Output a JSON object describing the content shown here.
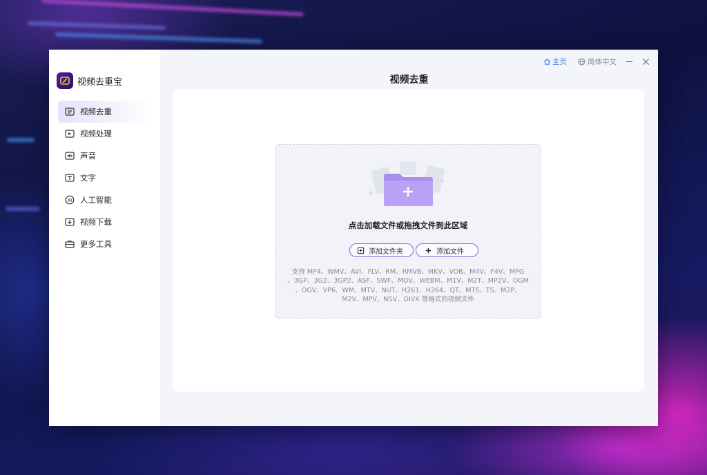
{
  "app": {
    "name": "视频去重宝"
  },
  "topbar": {
    "home_label": "主页",
    "lang_label": "简体中文"
  },
  "sidebar": {
    "items": [
      {
        "label": "视频去重",
        "icon": "video-dedupe-icon",
        "active": true
      },
      {
        "label": "视频处理",
        "icon": "video-process-icon",
        "active": false
      },
      {
        "label": "声音",
        "icon": "audio-icon",
        "active": false
      },
      {
        "label": "文字",
        "icon": "text-icon",
        "active": false
      },
      {
        "label": "人工智能",
        "icon": "ai-icon",
        "active": false
      },
      {
        "label": "视频下载",
        "icon": "download-icon",
        "active": false
      },
      {
        "label": "更多工具",
        "icon": "toolbox-icon",
        "active": false
      }
    ]
  },
  "main": {
    "title": "视频去重",
    "drop_text": "点击加载文件或拖拽文件到此区域",
    "add_folder_label": "添加文件夹",
    "add_file_label": "添加文件",
    "formats_lines": [
      "支持 MP4、WMV、AVI、FLV、RM、RMVB、MKV、VOB、M4V、F4V、MPG",
      "、3GP、3G2、3GP2、ASF、SWF、MOV、WEBM、M1V、M2T、MP2V、OGM",
      "、OGV、VP6、WM、MTV、NUT、H261、H264、QT、MTS、TS、M2P、",
      "M2V、MPV、NSV、DIVX 等格式的视频文件"
    ]
  },
  "colors": {
    "accent": "#8a63d8",
    "link": "#3a7be0",
    "active_bg": "#e6e2f8"
  }
}
